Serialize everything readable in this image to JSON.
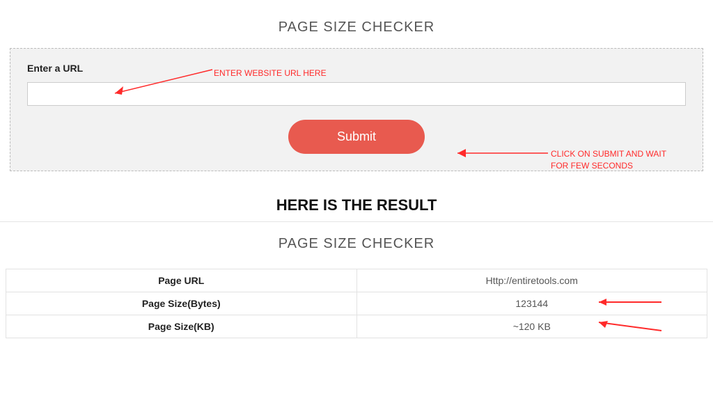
{
  "form": {
    "title": "PAGE SIZE CHECKER",
    "label": "Enter a URL",
    "input_value": "",
    "submit_label": "Submit"
  },
  "annotations": {
    "enter_url": "ENTER WEBSITE URL HERE",
    "click_submit": "CLICK ON SUBMIT AND WAIT FOR FEW SECONDS"
  },
  "result": {
    "heading": "HERE IS THE RESULT",
    "title": "PAGE SIZE CHECKER",
    "rows": [
      {
        "label": "Page URL",
        "value": "Http://entiretools.com"
      },
      {
        "label": "Page Size(Bytes)",
        "value": "123144"
      },
      {
        "label": "Page Size(KB)",
        "value": "~120 KB"
      }
    ]
  }
}
